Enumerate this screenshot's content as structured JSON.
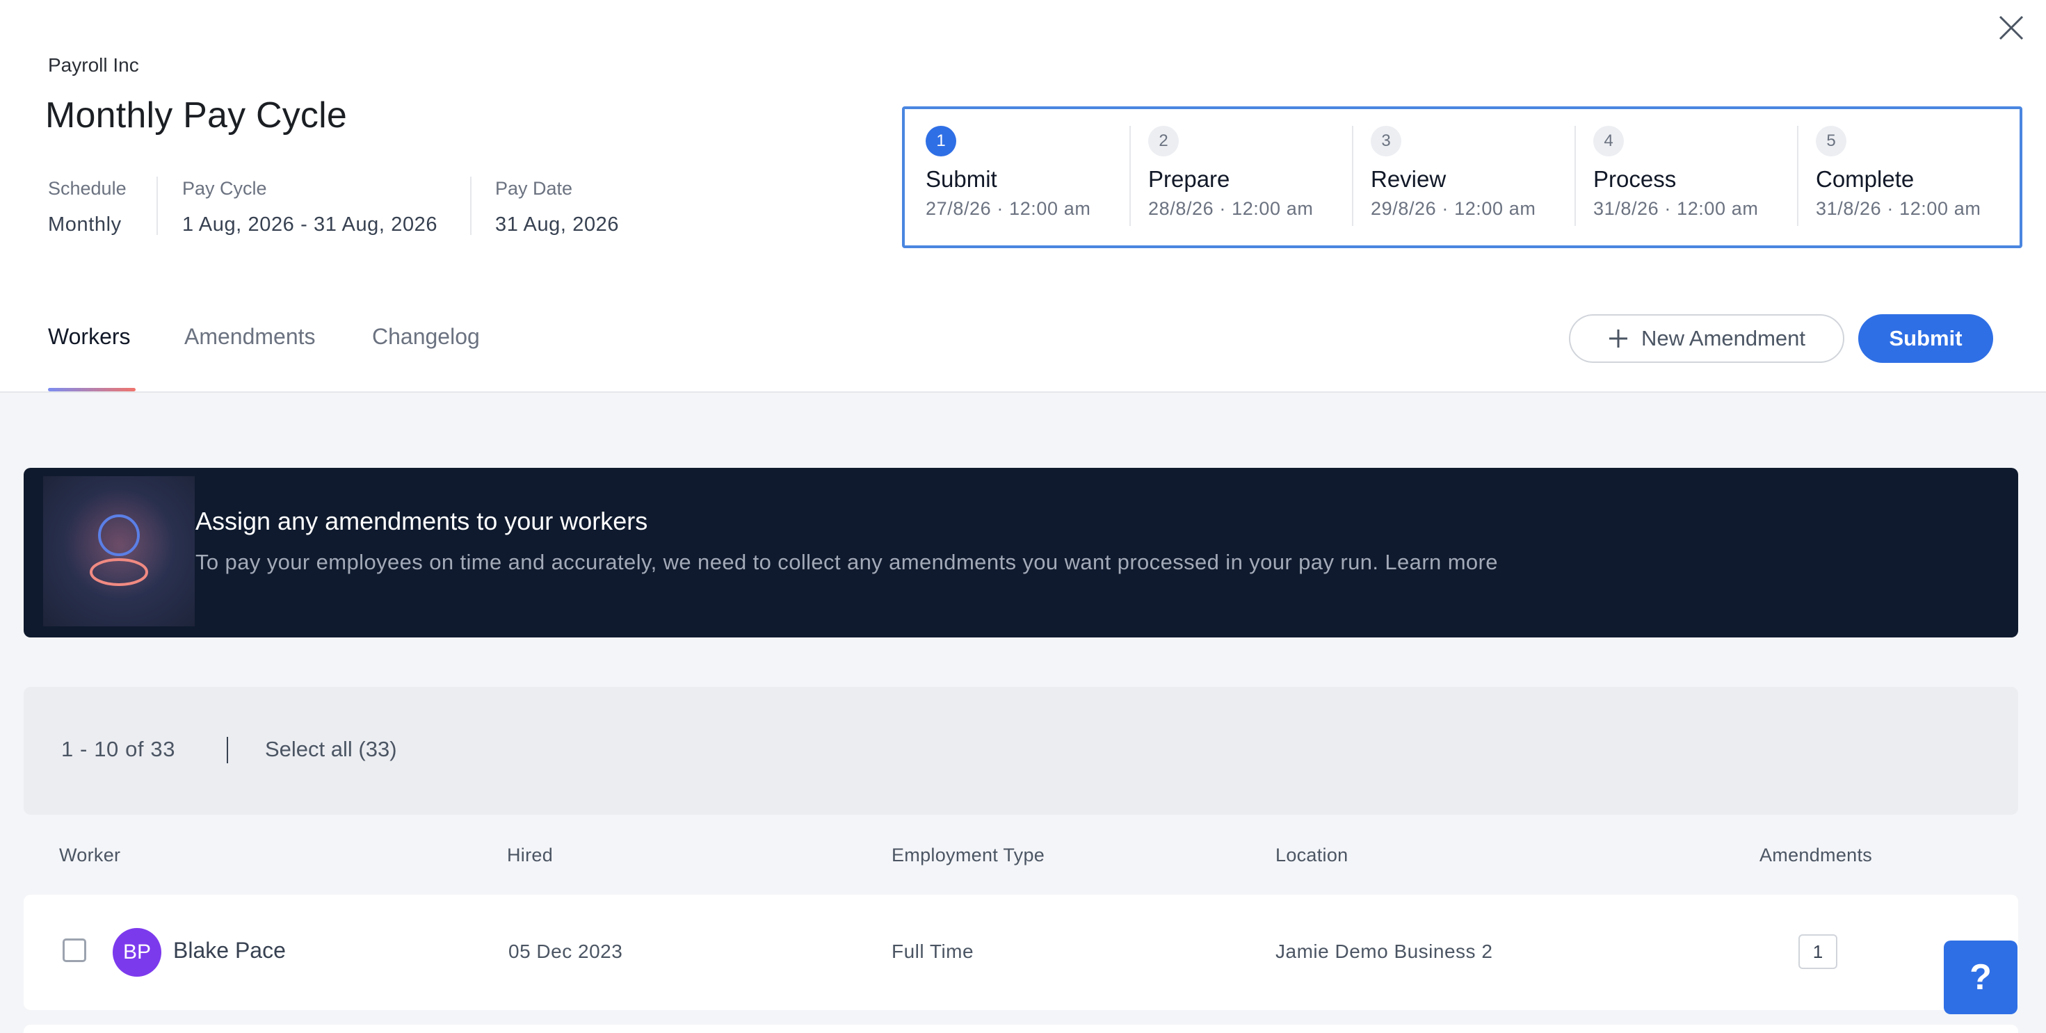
{
  "header": {
    "company": "Payroll Inc",
    "title": "Monthly Pay Cycle",
    "meta": [
      {
        "label": "Schedule",
        "value": "Monthly"
      },
      {
        "label": "Pay Cycle",
        "value": "1 Aug, 2026 - 31 Aug, 2026"
      },
      {
        "label": "Pay Date",
        "value": "31 Aug, 2026"
      }
    ]
  },
  "stepper": {
    "accent": "#2f6fe5",
    "steps": [
      {
        "num": "1",
        "name": "Submit",
        "date": "27/8/26 · 12:00 am",
        "active": true
      },
      {
        "num": "2",
        "name": "Prepare",
        "date": "28/8/26 · 12:00 am",
        "active": false
      },
      {
        "num": "3",
        "name": "Review",
        "date": "29/8/26 · 12:00 am",
        "active": false
      },
      {
        "num": "4",
        "name": "Process",
        "date": "31/8/26 · 12:00 am",
        "active": false
      },
      {
        "num": "5",
        "name": "Complete",
        "date": "31/8/26 · 12:00 am",
        "active": false
      }
    ]
  },
  "tabs": [
    {
      "label": "Workers",
      "active": true
    },
    {
      "label": "Amendments",
      "active": false
    },
    {
      "label": "Changelog",
      "active": false
    }
  ],
  "actions": {
    "new_amendment": "New Amendment",
    "submit": "Submit"
  },
  "banner": {
    "title": "Assign any amendments to your workers",
    "text": "To pay your employees on time and accurately, we need to collect any amendments you want processed in your pay run. Learn more"
  },
  "toolbar": {
    "range": "1 - 10 of 33",
    "select_all": "Select all (33)"
  },
  "table": {
    "headers": [
      "Worker",
      "Hired",
      "Employment Type",
      "Location",
      "Amendments"
    ],
    "rows": [
      {
        "initials": "BP",
        "name": "Blake Pace",
        "hired": "05 Dec 2023",
        "employment_type": "Full Time",
        "location": "Jamie Demo Business 2",
        "amendments": "1",
        "avatar_color": "#7c3aed"
      }
    ]
  },
  "help": {
    "label": "?"
  },
  "icons": {
    "close": "close-icon",
    "plus": "plus-icon",
    "help": "help-icon"
  }
}
